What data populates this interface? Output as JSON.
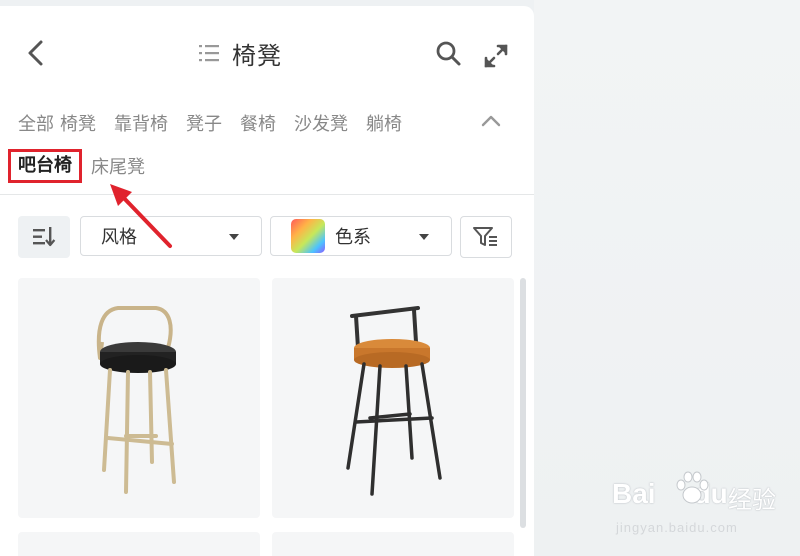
{
  "header": {
    "title": "椅凳",
    "icons": {
      "back": "chevron-left-icon",
      "list": "list-icon",
      "search": "search-icon",
      "expand": "expand-icon"
    }
  },
  "categories": {
    "row1": [
      "全部",
      "椅凳",
      "靠背椅",
      "凳子",
      "餐椅",
      "沙发凳",
      "躺椅"
    ],
    "active": "吧台椅",
    "row2_rest": [
      "床尾凳"
    ]
  },
  "filters": {
    "style_label": "风格",
    "color_label": "色系"
  },
  "colors": {
    "highlight_border": "#e0232d",
    "annotation_arrow": "#e0232d"
  },
  "products": [
    {
      "name_hint": "gold-frame black-seat bar stool"
    },
    {
      "name_hint": "black-frame orange-seat bar stool"
    }
  ],
  "watermark": {
    "logo_a": "Bai",
    "logo_b": "du",
    "brand": "经验",
    "url": "jingyan.baidu.com"
  }
}
